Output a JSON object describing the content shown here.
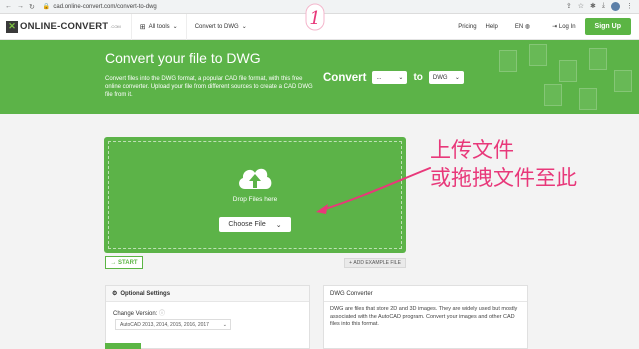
{
  "browser": {
    "url": "cad.online-convert.com/convert-to-dwg",
    "nav_icons": [
      "back-arrow",
      "forward-arrow",
      "reload"
    ]
  },
  "header": {
    "logo_text": "ONLINE-CONVERT",
    "logo_sub": ".COM",
    "all_tools": "All tools",
    "convert_to": "Convert to DWG",
    "pricing": "Pricing",
    "help": "Help",
    "lang": "EN",
    "login": "Log In",
    "signup": "Sign Up"
  },
  "hero": {
    "title": "Convert your file to DWG",
    "description": "Convert files into the DWG format, a popular CAD file format, with this free online converter. Upload your file from different sources to create a CAD DWG file from it.",
    "convert_label": "Convert",
    "from_value": "...",
    "to_label": "to",
    "to_value": "DWG"
  },
  "upload": {
    "drop_text": "Drop Files here",
    "choose_label": "Choose File"
  },
  "actions": {
    "start": "START",
    "add_example": "ADD EXAMPLE FILE"
  },
  "options": {
    "title": "Optional Settings",
    "change_version_label": "Change Version:",
    "version_value": "AutoCAD 2013, 2014, 2015, 2016, 2017"
  },
  "info": {
    "title": "DWG Converter",
    "text": "DWG are files that store 2D and 3D images. They are widely used but mostly associated with the AutoCAD program. Convert your images and other CAD files into this format."
  },
  "annotation": {
    "marker": "1",
    "line1": "上传文件",
    "line2": "或拖拽文件至此"
  },
  "colors": {
    "brand_green": "#5cb348",
    "annotation_pink": "#e8387a"
  }
}
